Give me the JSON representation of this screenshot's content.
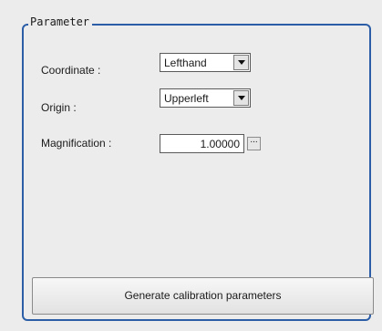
{
  "group": {
    "title": "Parameter"
  },
  "coordinate": {
    "label": "Coordinate :",
    "value": "Lefthand",
    "icon": "dropdown-arrow"
  },
  "origin": {
    "label": "Origin :",
    "value": "Upperleft",
    "icon": "dropdown-arrow"
  },
  "magnification": {
    "label": "Magnification :",
    "value": "1.00000",
    "browse_label": "..."
  },
  "actions": {
    "generate_label": "Generate calibration parameters"
  },
  "colors": {
    "panel_background": "#ececec",
    "group_border": "#2b5ea7"
  }
}
